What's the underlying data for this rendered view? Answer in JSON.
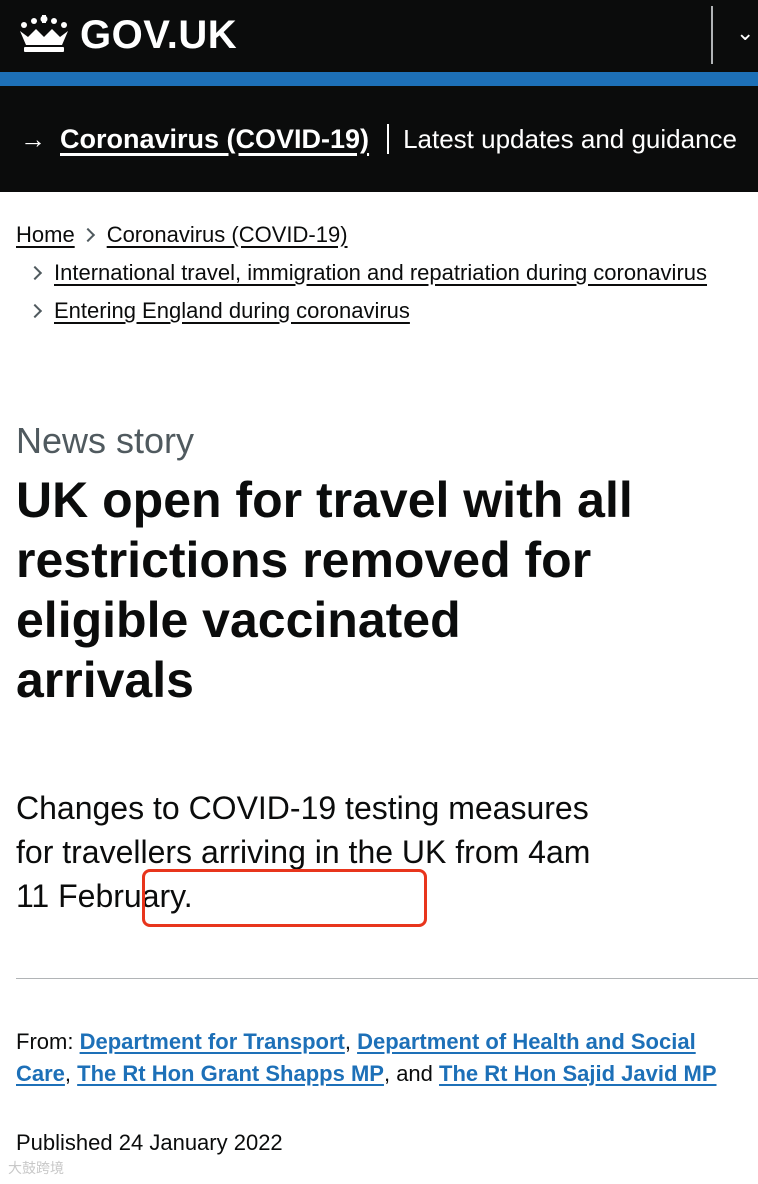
{
  "header": {
    "logo_text": "GOV.UK",
    "menu_glyph": "⌄"
  },
  "banner": {
    "arrow": "→",
    "link": "Coronavirus (COVID-19)",
    "text": "Latest updates and guidance"
  },
  "breadcrumbs": {
    "home": "Home",
    "covid": "Coronavirus (COVID-19)",
    "international": "International travel, immigration and repatriation during coronavirus",
    "entering": "Entering England during coronavirus"
  },
  "article": {
    "kicker": "News story",
    "title": "UK open for travel with all restrictions removed for eligible vaccinated arrivals",
    "lead_before": "Changes to COVID-19 testing measures for travellers arriving in the UK from ",
    "lead_date": "4am 11 February."
  },
  "meta": {
    "from_label": "From:",
    "org1": "Department for Transport",
    "org2": "Department of Health and Social Care",
    "person1": "The Rt Hon Grant Shapps MP",
    "and_label": "and",
    "person2": "The Rt Hon Sajid Javid MP",
    "published_label": "Published",
    "published_date": "24 January 2022"
  },
  "watermark": "大鼓跨境",
  "colors": {
    "header_bg": "#0b0c0c",
    "brand_blue": "#1d70b8",
    "highlight": "#e8351c"
  }
}
